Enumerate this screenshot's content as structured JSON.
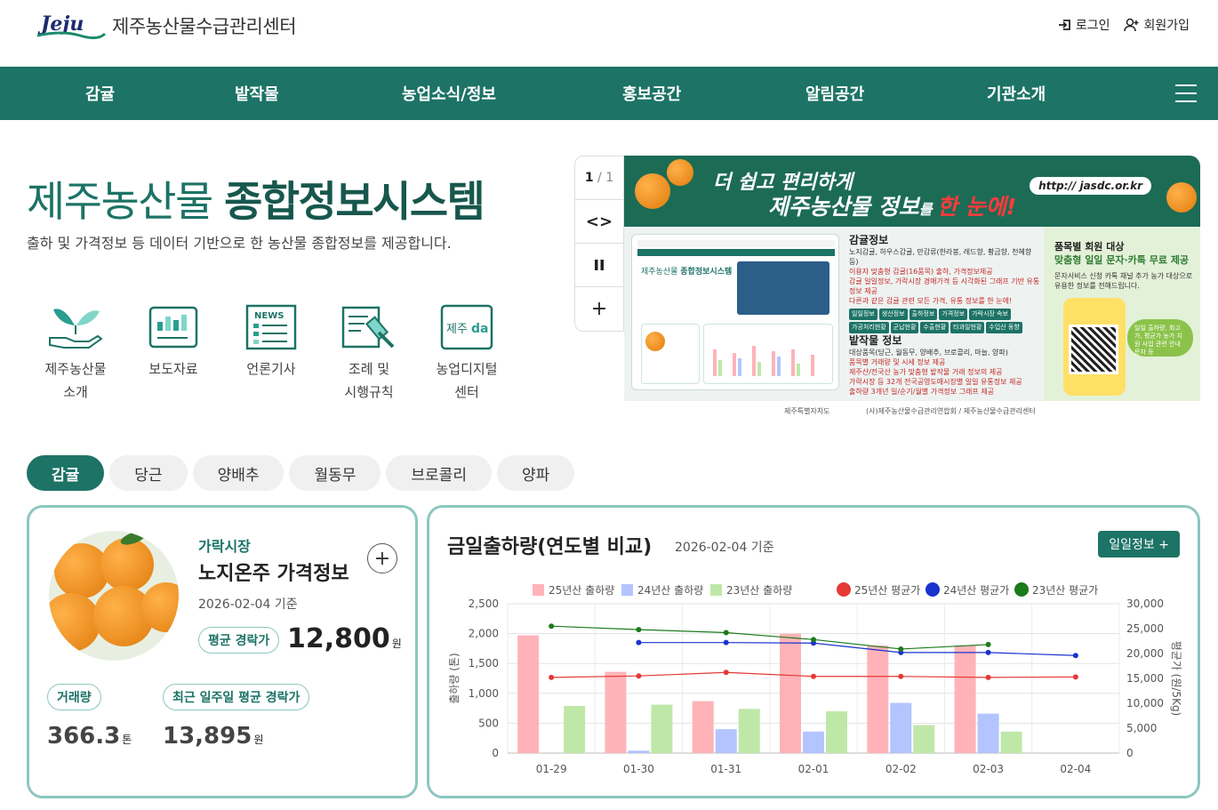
{
  "header": {
    "logo_text": "Jeju",
    "site_name": "제주농산물수급관리센터",
    "login": "로그인",
    "signup": "회원가입"
  },
  "nav": {
    "items": [
      "감귤",
      "밭작물",
      "농업소식/정보",
      "홍보공간",
      "알림공간",
      "기관소개"
    ]
  },
  "hero": {
    "title_normal": "제주농산물 ",
    "title_bold": "종합정보시스템",
    "subtitle": "출하 및 가격정보 등 데이터 기반으로 한 농산물 종합정보를 제공합니다."
  },
  "quick_links": [
    {
      "label": "제주농산물\n소개",
      "icon": "plant-hand-icon"
    },
    {
      "label": "보도자료",
      "icon": "bar-chart-icon"
    },
    {
      "label": "언론기사",
      "icon": "news-icon"
    },
    {
      "label": "조례 및\n시행규칙",
      "icon": "gavel-icon"
    },
    {
      "label": "농업디지털\n센터",
      "icon": "jeju-da-icon"
    }
  ],
  "slider": {
    "current": "1",
    "total": "1",
    "separator": "/",
    "prev_next": "<>",
    "pause": "pause-icon",
    "more": "+"
  },
  "banner": {
    "headline1": "더 쉽고 편리하게",
    "headline2_a": "제주농산물 정보",
    "headline2_b": "를 ",
    "headline2_c": "한 눈에!",
    "url": "http:// jasdc.or.kr",
    "citrus_title": "감귤정보",
    "citrus_desc": "노지감귤, 하우스감귤, 만감류(한라봉, 레드향, 황금향, 천혜향 등)",
    "citrus_points": [
      "이용자 맞춤형 감귤(16품목) 출하, 가격정보제공",
      "감귤 일일정보, 가락시장 경매가격 등 시각화된 그래프 기반 유통정보 제공",
      "다른과 같은 감귤 관련 모든 가격, 유통 정보를 한 눈에!"
    ],
    "citrus_tags": [
      "일일정보",
      "생산정보",
      "출하정보",
      "가격정보",
      "가락시장 속보",
      "가공처리현황",
      "군납현황",
      "수출현황",
      "타과일현황",
      "수입산 동향"
    ],
    "field_title": "밭작물 정보",
    "field_desc": "대상품목(당근, 월동무, 양배추, 브로콜리, 마늘, 양파)",
    "field_points": [
      "품목별 거래량 및 시세 정보 제공",
      "제주산/전국산 농가 맞춤형 밭작물 거래 정보의 제공",
      "가락시장 등 32개 전국공영도매시장별 일일 유통정보 제공",
      "출하량 3개년 일/순기/월별 가격정보 그래프 제공"
    ],
    "side_title": "품목별 회원 대상",
    "side_title2": "맞춤형 일일 문자·카톡 무료 제공",
    "side_sub": "문자서비스 신청  카톡 채널 추가  농가 대상으로 유용한 정보를 전해드립니다.",
    "side_bubble": "일일 출하량, 최고가, 평균가 농가 지원 사업 관련 안내 문자 등",
    "foot_left": "제주특별자치도",
    "foot_right": "(사)제주농산물수급관리연합회 / 제주농산물수급관리센터"
  },
  "crop_tabs": [
    "감귤",
    "당근",
    "양배추",
    "월동무",
    "브로콜리",
    "양파"
  ],
  "price_card": {
    "market": "가락시장",
    "name": "노지온주 가격정보",
    "plus": "+",
    "date": "2026-02-04 기준",
    "avg_label": "평균 경락가",
    "avg_value": "12,800",
    "avg_unit": "원",
    "volume_label": "거래량",
    "volume_value": "366.3",
    "volume_unit": "톤",
    "week_label": "최근 일주일 평균 경락가",
    "week_value": "13,895",
    "week_unit": "원"
  },
  "shipment_card": {
    "title": "금일출하량(연도별 비교)",
    "date": "2026-02-04 기준",
    "button": "일일정보 +"
  },
  "chart_data": {
    "type": "bar",
    "categories": [
      "01-29",
      "01-30",
      "01-31",
      "02-01",
      "02-02",
      "02-03",
      "02-04"
    ],
    "ylabel": "출하량 (톤)",
    "y2label": "평균가 (원/5Kg)",
    "ylim": [
      0,
      2500
    ],
    "y2lim": [
      0,
      30000
    ],
    "yticks": [
      "0",
      "500",
      "1,000",
      "1,500",
      "2,000",
      "2,500"
    ],
    "y2ticks": [
      "0",
      "5,000",
      "10,000",
      "15,000",
      "20,000",
      "25,000",
      "30,000"
    ],
    "legend_position": "top",
    "grid": true,
    "bar_series": [
      {
        "name": "25년산 출하량",
        "color": "#ffb3b8",
        "values": [
          1970,
          1360,
          870,
          2000,
          1800,
          1800,
          null
        ]
      },
      {
        "name": "24년산 출하량",
        "color": "#b3c4ff",
        "values": [
          null,
          40,
          400,
          360,
          840,
          660,
          null
        ]
      },
      {
        "name": "23년산 출하량",
        "color": "#bfe8a8",
        "values": [
          790,
          810,
          740,
          700,
          470,
          360,
          null
        ]
      }
    ],
    "line_series": [
      {
        "name": "25년산 평균가",
        "color": "#e53935",
        "values": [
          15200,
          15500,
          16200,
          15400,
          15400,
          15200,
          15300
        ]
      },
      {
        "name": "24년산 평균가",
        "color": "#1a33cc",
        "values": [
          null,
          22200,
          22200,
          22100,
          20200,
          20200,
          19600
        ]
      },
      {
        "name": "23년산 평균가",
        "color": "#1b7a1b",
        "values": [
          25500,
          24800,
          24200,
          22800,
          20900,
          21800,
          null
        ]
      }
    ]
  }
}
